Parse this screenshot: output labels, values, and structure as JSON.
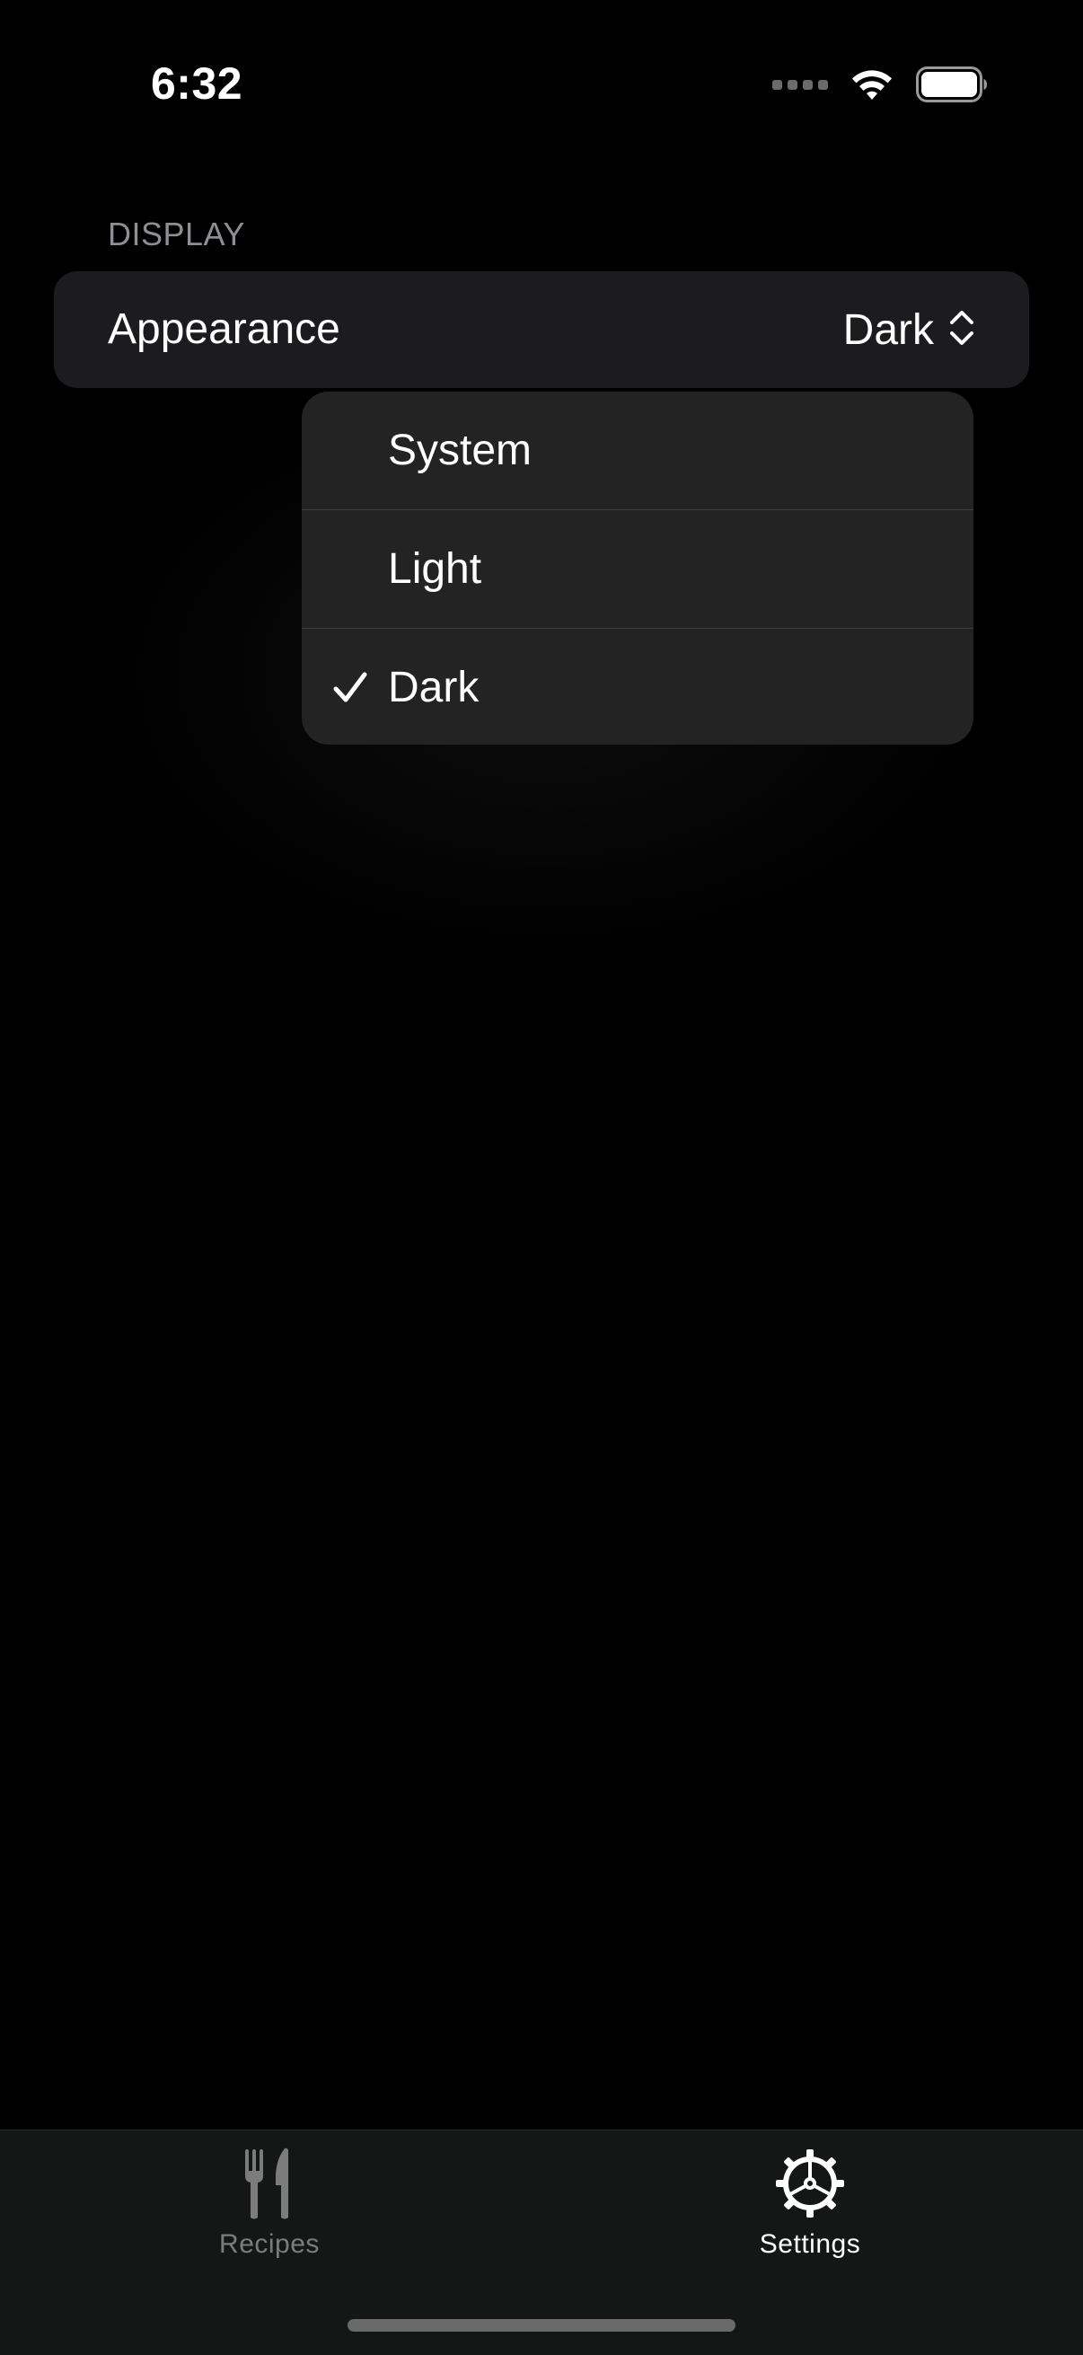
{
  "status_bar": {
    "time": "6:32",
    "icons": [
      "signal-icon",
      "wifi-icon",
      "battery-icon"
    ]
  },
  "display_section": {
    "header": "DISPLAY",
    "appearance_row": {
      "label": "Appearance",
      "value": "Dark",
      "icon": "chevron-up-down-icon"
    }
  },
  "appearance_menu": {
    "options": [
      {
        "label": "System",
        "selected": false
      },
      {
        "label": "Light",
        "selected": false
      },
      {
        "label": "Dark",
        "selected": true
      }
    ],
    "selected_icon": "checkmark-icon"
  },
  "tab_bar": {
    "tabs": [
      {
        "label": "Recipes",
        "icon": "fork-knife-icon",
        "active": false
      },
      {
        "label": "Settings",
        "icon": "gear-icon",
        "active": true
      }
    ]
  },
  "colors": {
    "background": "#000000",
    "group_background": "#1c1c1e",
    "menu_background": "#232323",
    "tab_bar_background": "#151616",
    "secondary_text": "#8e8e93",
    "inactive_tab": "#7c7c7c"
  }
}
